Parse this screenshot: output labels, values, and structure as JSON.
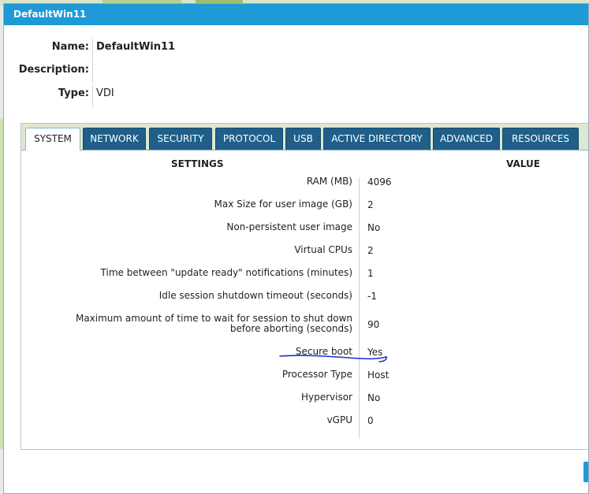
{
  "dialog": {
    "title": "DefaultWin11"
  },
  "info": [
    {
      "label": "Name:",
      "value": "DefaultWin11",
      "bold": true
    },
    {
      "label": "Description:",
      "value": ""
    },
    {
      "label": "Type:",
      "value": "VDI"
    }
  ],
  "tabs": [
    {
      "label": "SYSTEM",
      "active": true
    },
    {
      "label": "NETWORK"
    },
    {
      "label": "SECURITY"
    },
    {
      "label": "PROTOCOL"
    },
    {
      "label": "USB"
    },
    {
      "label": "ACTIVE DIRECTORY"
    },
    {
      "label": "ADVANCED"
    },
    {
      "label": "RESOURCES"
    }
  ],
  "table": {
    "headers": {
      "settings": "SETTINGS",
      "value": "VALUE"
    },
    "rows": [
      {
        "setting": "RAM (MB)",
        "value": "4096"
      },
      {
        "setting": "Max Size for user image (GB)",
        "value": "2"
      },
      {
        "setting": "Non-persistent user image",
        "value": "No"
      },
      {
        "setting": "Virtual CPUs",
        "value": "2"
      },
      {
        "setting": "Time between \"update ready\" notifications (minutes)",
        "value": "1"
      },
      {
        "setting": "Idle session shutdown timeout (seconds)",
        "value": "-1"
      },
      {
        "setting": "Maximum amount of time to wait for session to shut down before aborting (seconds)",
        "value": "90"
      },
      {
        "setting": "Secure boot",
        "value": "Yes"
      },
      {
        "setting": "Processor Type",
        "value": "Host"
      },
      {
        "setting": "Hypervisor",
        "value": "No"
      },
      {
        "setting": "vGPU",
        "value": "0"
      }
    ]
  },
  "colors": {
    "titlebar": "#1e9ad6",
    "tab": "#1f5f89",
    "annotation": "#1a2fd6"
  }
}
